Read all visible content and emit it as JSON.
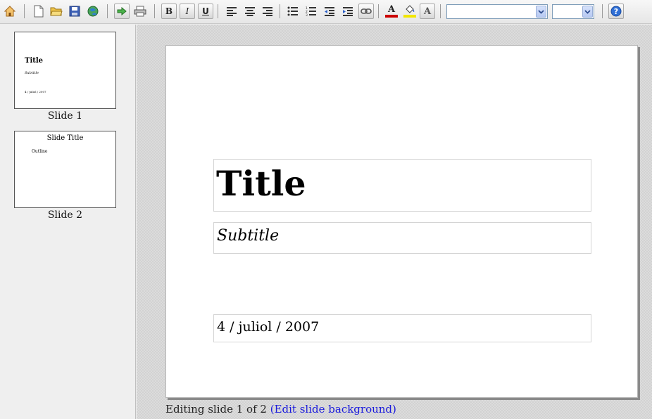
{
  "toolbar": {
    "buttons": [
      {
        "name": "home-icon",
        "glyph": ""
      },
      {
        "name": "new-document-icon",
        "glyph": ""
      },
      {
        "name": "open-folder-icon",
        "glyph": ""
      },
      {
        "name": "save-icon",
        "glyph": ""
      },
      {
        "name": "web-globe-icon",
        "glyph": ""
      },
      {
        "name": "go-arrow-icon",
        "glyph": ""
      },
      {
        "name": "print-icon",
        "glyph": ""
      },
      {
        "name": "bold-icon",
        "glyph": "B"
      },
      {
        "name": "italic-icon",
        "glyph": "I"
      },
      {
        "name": "underline-icon",
        "glyph": "U"
      },
      {
        "name": "align-left-icon",
        "glyph": ""
      },
      {
        "name": "align-center-icon",
        "glyph": ""
      },
      {
        "name": "align-right-icon",
        "glyph": ""
      },
      {
        "name": "bullet-list-icon",
        "glyph": ""
      },
      {
        "name": "numbered-list-icon",
        "glyph": ""
      },
      {
        "name": "outdent-icon",
        "glyph": ""
      },
      {
        "name": "indent-icon",
        "glyph": ""
      },
      {
        "name": "link-icon",
        "glyph": ""
      },
      {
        "name": "font-color-icon",
        "glyph": "A"
      },
      {
        "name": "fill-color-icon",
        "glyph": ""
      },
      {
        "name": "text-shadow-icon",
        "glyph": "A"
      },
      {
        "name": "help-icon",
        "glyph": "?"
      }
    ],
    "font_family_value": "",
    "font_size_value": "",
    "colors": {
      "font_color": "#cc0000",
      "fill_color": "#f2e600"
    }
  },
  "sidebar": {
    "slides": [
      {
        "label": "Slide 1",
        "title": "Title",
        "subtitle": "Subtitle",
        "date": "4 / juliol / 2007"
      },
      {
        "label": "Slide 2",
        "title": "Slide Title",
        "outline": "Outline"
      }
    ]
  },
  "slide": {
    "title": "Title",
    "subtitle": "Subtitle",
    "date": "4 / juliol / 2007"
  },
  "status": {
    "text": "Editing slide 1 of 2",
    "link": "(Edit slide background)"
  }
}
